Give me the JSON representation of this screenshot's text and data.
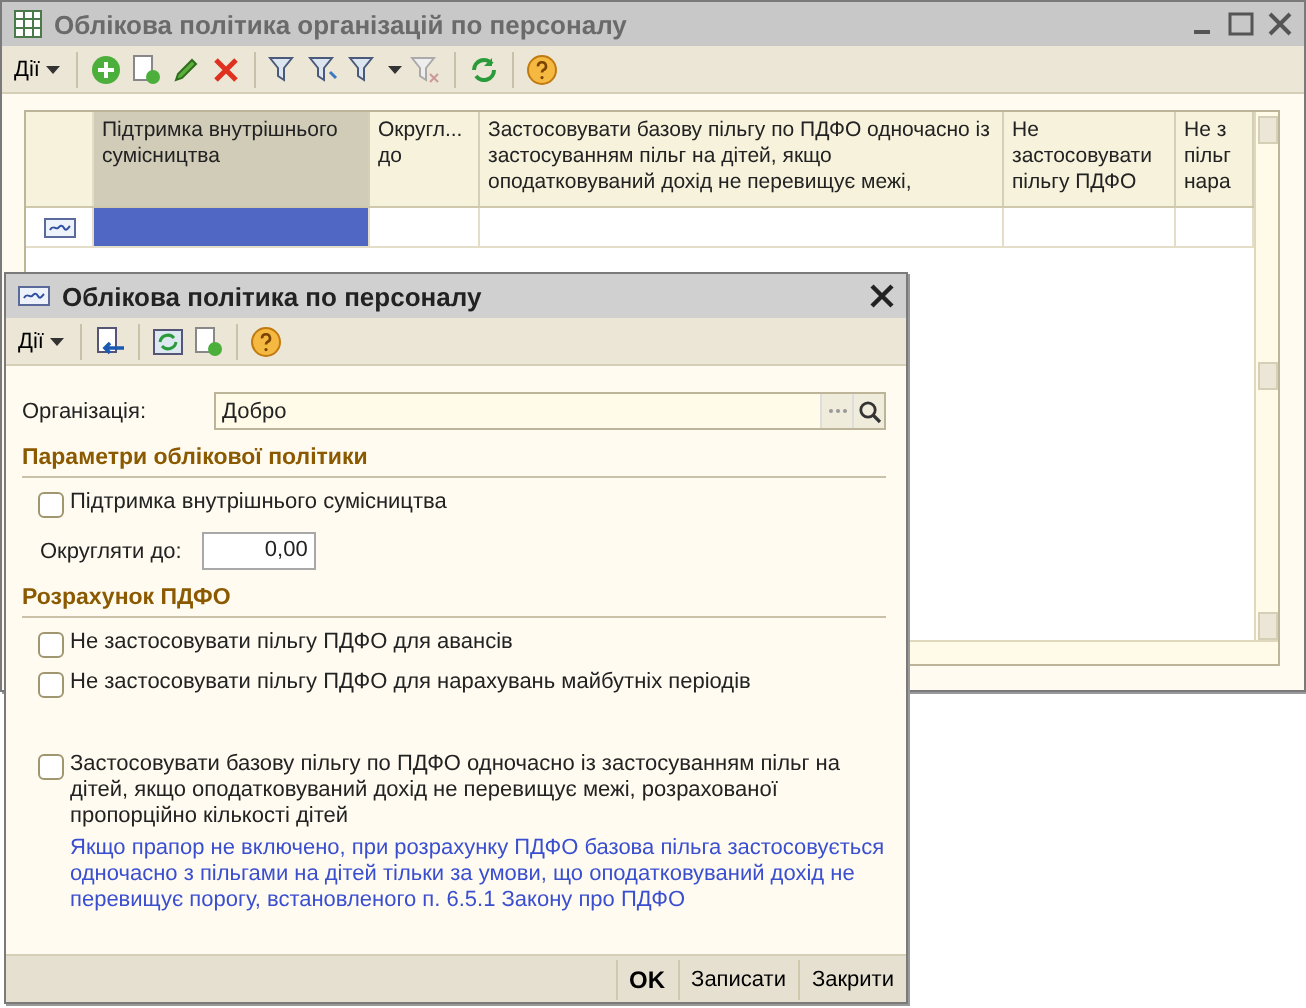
{
  "back_window": {
    "title": "Облікова політика організацій по персоналу",
    "menu": "Дії",
    "table": {
      "columns": [
        {
          "label": "Підтримка внутрішнього сумісництва",
          "selected": true
        },
        {
          "label": "Округл... до",
          "selected": false
        },
        {
          "label": "Застосовувати базову пільгу по ПДФО одночасно із застосуванням пільг на дітей, якщо оподатковуваний дохід не перевищує межі,",
          "selected": false
        },
        {
          "label": "Не застосовувати пільгу ПДФО",
          "selected": false
        },
        {
          "label": "Не з пільг нара",
          "selected": false
        }
      ],
      "rows": [
        {
          "selected": true
        }
      ]
    }
  },
  "front_window": {
    "title": "Облікова політика по персоналу",
    "menu": "Дії",
    "organization": {
      "label": "Організація:",
      "value": "Добро"
    },
    "sections": [
      {
        "title": "Параметри облікової політики",
        "items": [
          {
            "kind": "checkbox",
            "label": "Підтримка внутрішнього сумісництва",
            "checked": false
          },
          {
            "kind": "number",
            "label": "Округляти до:",
            "value": "0,00"
          }
        ]
      },
      {
        "title": "Розрахунок ПДФО",
        "items": [
          {
            "kind": "checkbox",
            "label": "Не застосовувати пільгу ПДФО для авансів",
            "checked": false
          },
          {
            "kind": "checkbox",
            "label": "Не застосовувати пільгу ПДФО для нарахувань майбутніх періодів",
            "checked": false
          },
          {
            "kind": "checkbox",
            "label": "Застосовувати базову пільгу по ПДФО одночасно із застосуванням пільг на дітей, якщо оподатковуваний дохід не перевищує межі, розрахованої пропорційно кількості дітей",
            "checked": false,
            "hint": "Якщо прапор не включено, при розрахунку ПДФО базова пільга застосовується одночасно з пільгами на дітей тільки за умови, що оподатковуваний дохід не перевищує порогу, встановленого п. 6.5.1 Закону про ПДФО"
          }
        ]
      }
    ],
    "buttons": [
      {
        "label": "OK",
        "default": true
      },
      {
        "label": "Записати",
        "default": false
      },
      {
        "label": "Закрити",
        "default": false
      }
    ]
  }
}
